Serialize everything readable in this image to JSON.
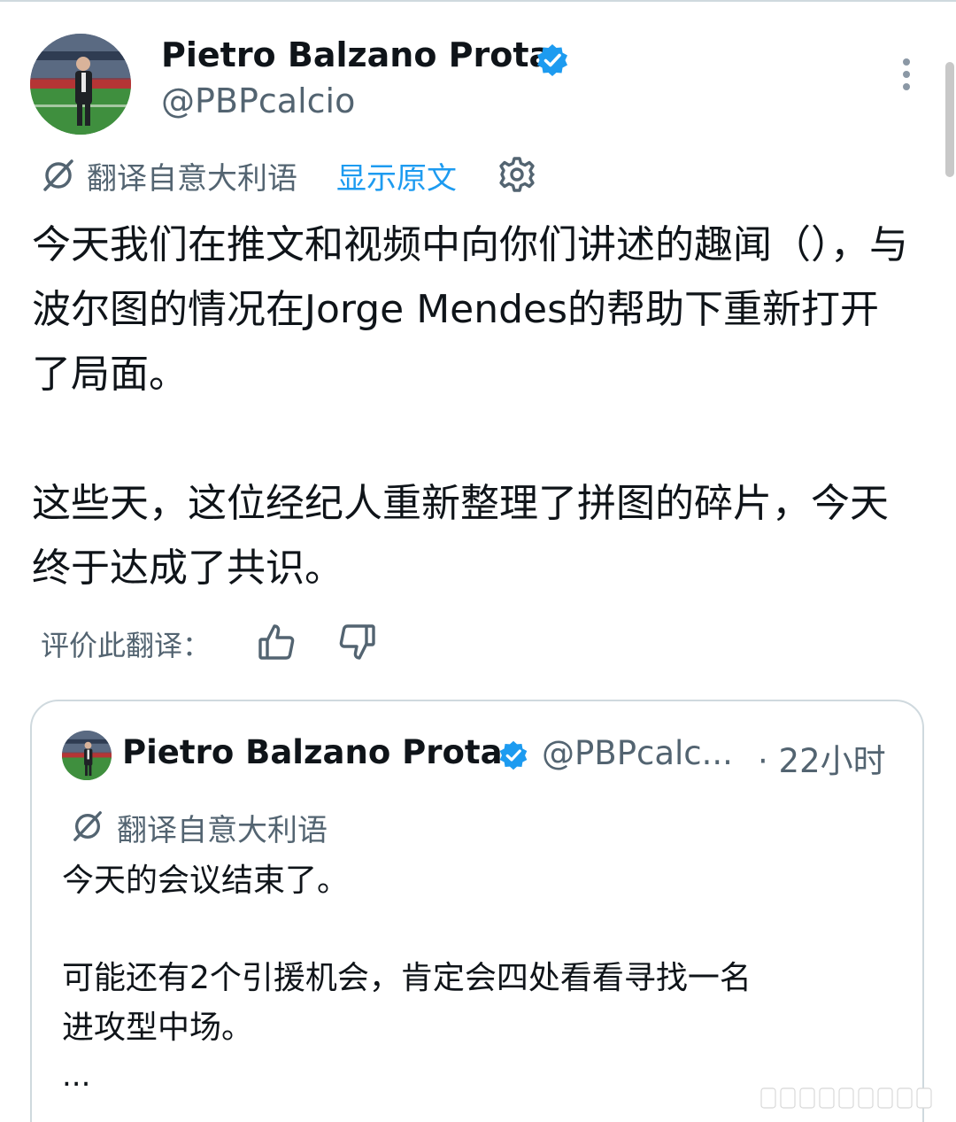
{
  "author": {
    "display_name": "Pietro Balzano Prota",
    "handle": "@PBPcalcio"
  },
  "translate_bar": {
    "label": "翻译自意大利语",
    "show_original": "显示原文"
  },
  "tweet": {
    "paragraphs": [
      "今天我们在推文和视频中向你们讲述的趣闻（），与波尔图的情况在Jorge Mendes的帮助下重新打开了局面。",
      "这些天，这位经纪人重新整理了拼图的碎片，今天终于达成了共识。"
    ]
  },
  "rating": {
    "label": "评价此翻译："
  },
  "quoted": {
    "display_name": "Pietro Balzano Prota",
    "handle": "@PBPcalc...",
    "time": "· 22小时",
    "translate_label": "翻译自意大利语",
    "line1": "今天的会议结束了。",
    "line2": "可能还有2个引援机会，肯定会四处看看寻找一名",
    "line3": "进攻型中场。",
    "ellipsis": "..."
  },
  "colors": {
    "accent": "#1d9bf0",
    "muted": "#536471",
    "text": "#0f1419",
    "border": "#cfd9de"
  },
  "icons": [
    "verified-badge-icon",
    "more-vertical-icon",
    "translate-icon",
    "settings-gear-icon",
    "thumbs-up-icon",
    "thumbs-down-icon"
  ]
}
